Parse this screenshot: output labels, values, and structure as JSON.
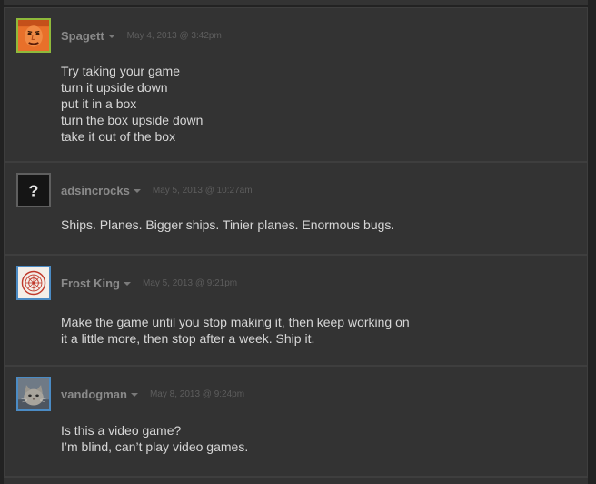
{
  "comments": [
    {
      "author": "Spagett",
      "timestamp": "May 4, 2013 @ 3:42pm",
      "text": "Try taking your game\nturn it upside down\nput it in a box\nturn the box upside down\ntake it out of the box",
      "avatar_icon": "orange-face-avatar",
      "status": "online"
    },
    {
      "author": "adsincrocks",
      "timestamp": "May 5, 2013 @ 10:27am",
      "text": "Ships. Planes. Bigger ships. Tinier planes. Enormous bugs.",
      "avatar_icon": "question-mark-avatar",
      "avatar_glyph": "?",
      "status": "offline"
    },
    {
      "author": "Frost King",
      "timestamp": "May 5, 2013 @ 9:21pm",
      "text": "Make the game until you stop making it, then keep working on\nit a little more, then stop after a week. Ship it.",
      "avatar_icon": "red-seal-avatar",
      "status": "ingame"
    },
    {
      "author": "vandogman",
      "timestamp": "May 8, 2013 @ 9:24pm",
      "text": "Is this a video game?\nI’m blind, can’t play video games.",
      "avatar_icon": "cat-photo-avatar",
      "status": "ingame"
    }
  ],
  "colors": {
    "background": "#222222",
    "card": "#333333",
    "author": "#8a8a8a",
    "timestamp": "#5d5d5d",
    "text": "#d6d6d6",
    "online_border": "#8fb93b",
    "ingame_border": "#4b8bc4"
  }
}
